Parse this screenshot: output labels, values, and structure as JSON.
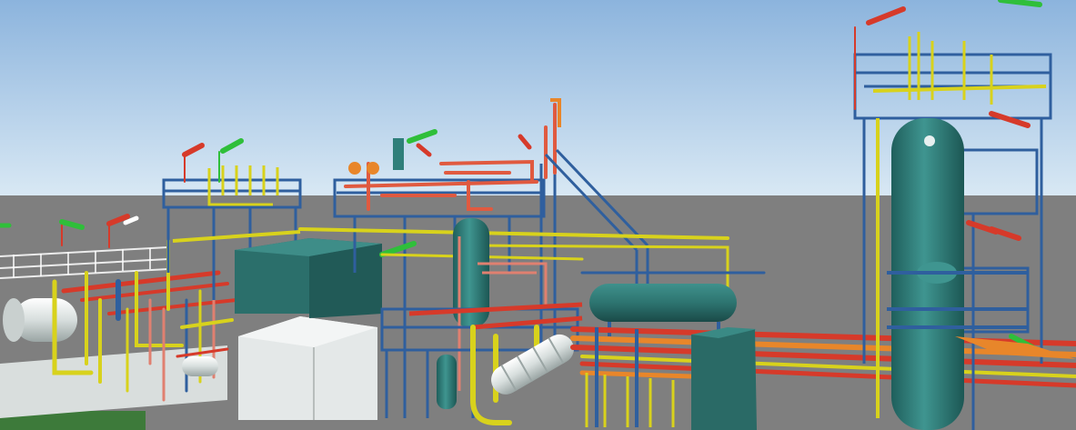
{
  "scene": {
    "type": "3d-plant-model-render",
    "colors": {
      "sky_top": "#8fb6de",
      "sky_bottom": "#d4e6f3",
      "ground": "#808080",
      "steel_blue": "#2f5f9e",
      "vessel_teal": "#2f7f7a",
      "pipe_red": "#d63a2a",
      "pipe_yellow": "#d8d21c",
      "pipe_orange": "#e8862a",
      "pipe_salmon": "#e08070",
      "equipment_white": "#e6ecec",
      "slab_white": "#d9dedd",
      "vent_green": "#2fbf3a"
    },
    "icons": [
      "vent-stack-icon",
      "column-vessel-icon",
      "heat-exchanger-icon",
      "pipe-rack-icon",
      "stair-icon"
    ]
  }
}
